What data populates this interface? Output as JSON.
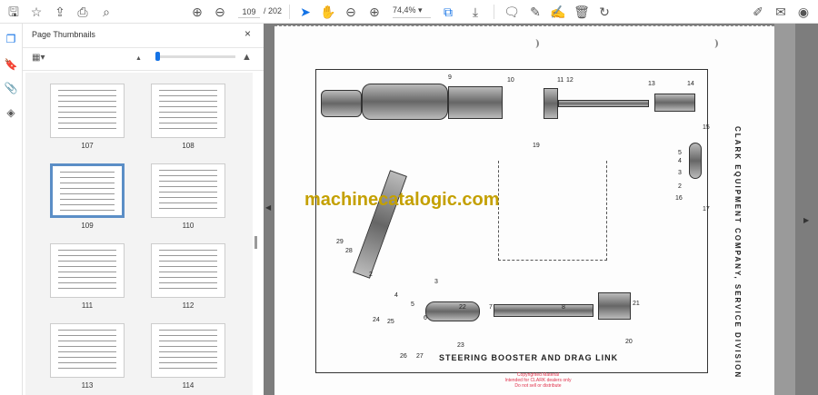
{
  "toolbar": {
    "icons": [
      "save-icon",
      "bookmark-star-icon",
      "upload-icon",
      "print-icon",
      "find-icon",
      "previous-page-icon",
      "next-page-icon",
      "select-cursor-icon",
      "hand-icon",
      "zoom-out-icon",
      "zoom-in-icon",
      "page-fit-icon",
      "scroll-mode-icon",
      "comment-icon",
      "pen-icon",
      "sign-icon",
      "delete-icon",
      "rotate-icon",
      "fill-sign-icon",
      "mail-icon",
      "account-icon"
    ],
    "current_page": "109",
    "total_pages": "/ 202",
    "zoom": "74,4%"
  },
  "panel": {
    "title": "Page Thumbnails",
    "close": "×",
    "thumbnails": [
      {
        "label": "107"
      },
      {
        "label": "108"
      },
      {
        "label": "109",
        "selected": true
      },
      {
        "label": "110"
      },
      {
        "label": "111"
      },
      {
        "label": "112"
      },
      {
        "label": "113"
      },
      {
        "label": "114"
      }
    ]
  },
  "document": {
    "figure_title": "STEERING BOOSTER AND DRAG LINK",
    "side_text": "CLARK EQUIPMENT COMPANY, SERVICE DIVISION",
    "watermark": "machinecatalogic.com",
    "copyright": [
      "Copyrighted Material",
      "Intended for CLARK dealers only",
      "Do not sell or distribute"
    ],
    "callouts": [
      "9",
      "10",
      "11",
      "12",
      "13",
      "14",
      "15",
      "5",
      "4",
      "3",
      "2",
      "16",
      "17",
      "19",
      "29",
      "28",
      "2",
      "3",
      "4",
      "5",
      "6",
      "22",
      "7",
      "8",
      "21",
      "24",
      "25",
      "26",
      "27",
      "23",
      "20"
    ]
  },
  "colors": {
    "accent": "#1473e6",
    "watermark": "#c4a000",
    "copyright": "#e0304a"
  }
}
